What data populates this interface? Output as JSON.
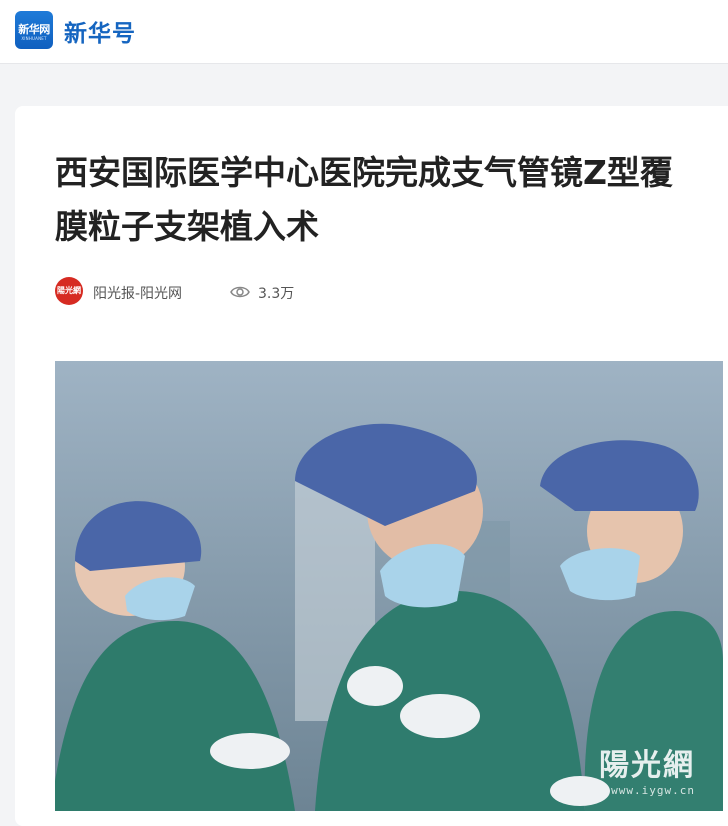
{
  "header": {
    "logo_text": "新华网",
    "logo_subtext": "XINHUANET",
    "brand_name": "新华号"
  },
  "article": {
    "title": "西安国际医学中心医院完成支气管镜Z型覆膜粒子支架植入术",
    "source_name": "阳光报-阳光网",
    "source_logo_text": "陽光網",
    "views_icon": "eye-icon",
    "views": "3.3万"
  },
  "photo": {
    "watermark_name": "陽光網",
    "watermark_url": "www.iygw.cn"
  },
  "colors": {
    "brand_blue": "#1565c0",
    "page_bg": "#f3f4f6",
    "source_red": "#d62b22",
    "scrub_green": "#2e7b6b",
    "cap_blue": "#4a66a8"
  }
}
